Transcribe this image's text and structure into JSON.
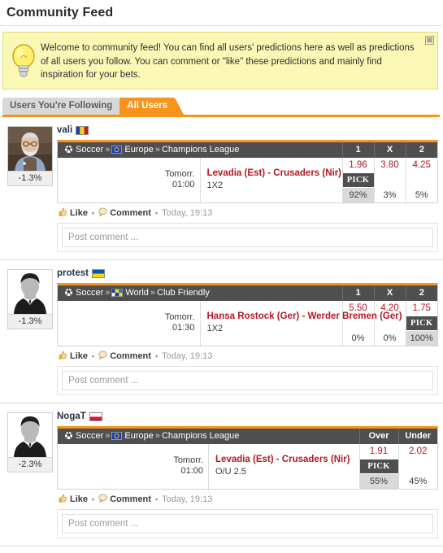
{
  "page": {
    "title": "Community Feed"
  },
  "banner": {
    "icon": "lightbulb-icon",
    "text": "Welcome to community feed! You can find all users' predictions here as well as predictions of all users you follow. You can comment or \"like\" these predictions and mainly find inspiration for your bets.",
    "close_label": "⊠",
    "background": "#fbf8b6",
    "border": "#e4d97a"
  },
  "tabs": {
    "items": [
      {
        "label": "Users You're Following",
        "active": false
      },
      {
        "label": "All Users",
        "active": true
      }
    ],
    "accent": "#f7941e"
  },
  "common": {
    "like_label": "Like",
    "comment_label": "Comment",
    "separator": "▪",
    "comment_placeholder": "Post comment ...",
    "sport_label": "Soccer",
    "crumb_sep": "»"
  },
  "posts": [
    {
      "user": {
        "name": "vali",
        "flag": "romania-flag",
        "profit": "-1.3%",
        "avatar": "photo"
      },
      "bet": {
        "sport": "Soccer",
        "region": "Europe",
        "region_icon": "europe-flag",
        "league": "Champions League",
        "time_day": "Tomorr.",
        "time_hour": "01:00",
        "match": "Levadia (Est) - Crusaders (Nir)",
        "market": "1X2",
        "columns": [
          {
            "header": "1",
            "odd": "1.96",
            "pick": true,
            "pct": "92%"
          },
          {
            "header": "X",
            "odd": "3.80",
            "pick": false,
            "pct": "3%"
          },
          {
            "header": "2",
            "odd": "4.25",
            "pick": false,
            "pct": "5%"
          }
        ],
        "pick_label": "PICK"
      },
      "timestamp": "Today, 19:13"
    },
    {
      "user": {
        "name": "protest",
        "flag": "ukraine-flag",
        "profit": "-1.3%",
        "avatar": "silhouette"
      },
      "bet": {
        "sport": "Soccer",
        "region": "World",
        "region_icon": "world-flag",
        "league": "Club Friendly",
        "time_day": "Tomorr.",
        "time_hour": "01:30",
        "match": "Hansa Rostock (Ger) - Werder Bremen (Ger)",
        "market": "1X2",
        "columns": [
          {
            "header": "1",
            "odd": "5.50",
            "pick": false,
            "pct": "0%"
          },
          {
            "header": "X",
            "odd": "4.20",
            "pick": false,
            "pct": "0%"
          },
          {
            "header": "2",
            "odd": "1.75",
            "pick": true,
            "pct": "100%"
          }
        ],
        "pick_label": "PICK"
      },
      "timestamp": "Today, 19:13"
    },
    {
      "user": {
        "name": "NogaT",
        "flag": "poland-flag",
        "profit": "-2.3%",
        "avatar": "silhouette"
      },
      "bet": {
        "sport": "Soccer",
        "region": "Europe",
        "region_icon": "europe-flag",
        "league": "Champions League",
        "time_day": "Tomorr.",
        "time_hour": "01:00",
        "match": "Levadia (Est) - Crusaders (Nir)",
        "market": "O/U 2.5",
        "columns": [
          {
            "header": "Over",
            "odd": "1.91",
            "pick": true,
            "pct": "55%"
          },
          {
            "header": "Under",
            "odd": "2.02",
            "pick": false,
            "pct": "45%"
          }
        ],
        "pick_label": "PICK"
      },
      "timestamp": "Today, 19:13"
    }
  ]
}
